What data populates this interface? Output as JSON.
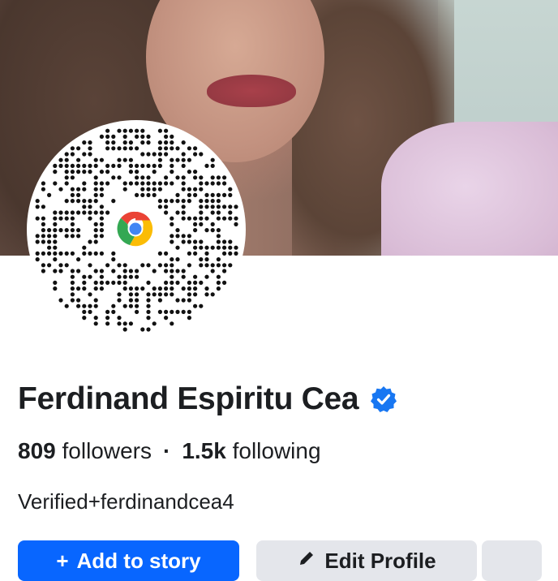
{
  "profile": {
    "name": "Ferdinand Espiritu Cea",
    "followers_count": "809",
    "followers_label": "followers",
    "separator": "·",
    "following_count": "1.5k",
    "following_label": "following",
    "bio": "Verified+ferdinandcea4"
  },
  "actions": {
    "primary_icon": "+",
    "primary_label": "Add to story",
    "edit_icon": "pencil-icon",
    "edit_label": "Edit Profile"
  },
  "colors": {
    "primary_button": "#0866ff",
    "secondary_button": "#e4e6eb",
    "verified_badge": "#1877f2",
    "text": "#1c1e21"
  }
}
